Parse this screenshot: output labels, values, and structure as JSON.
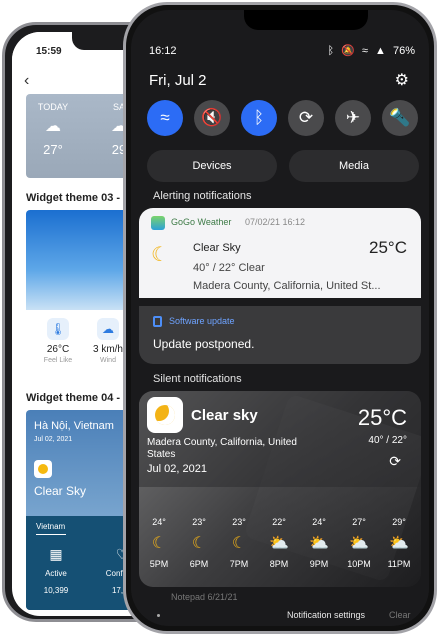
{
  "back_phone": {
    "time": "15:59",
    "back_arrow": "‹",
    "forecast": [
      {
        "day": "TODAY",
        "icon": "cloud-icon",
        "temp": "27°"
      },
      {
        "day": "SA",
        "icon": "cloud-icon",
        "temp": "29"
      }
    ],
    "theme3_label": "Widget theme 03 - Cl",
    "theme3_metrics": [
      {
        "value": "26°C",
        "sub": "Feel Like",
        "icon": "thermometer-icon"
      },
      {
        "value": "3 km/h",
        "sub": "Wind",
        "icon": "wind-icon"
      }
    ],
    "theme4_label": "Widget theme 04 - Co",
    "theme4": {
      "city": "Hà Nội, Vietnam",
      "date": "Jul 02, 2021",
      "condition": "Clear Sky",
      "tab": "Vietnam",
      "stats": [
        {
          "label": "Active",
          "value": "10,399",
          "icon": "hospital-icon"
        },
        {
          "label": "Confirme",
          "value": "17,90",
          "icon": "hands-icon"
        }
      ]
    }
  },
  "front_phone": {
    "status_time": "16:12",
    "status_icons": [
      "bluetooth-icon",
      "mute-icon",
      "wifi-icon",
      "signal-icon"
    ],
    "battery": "76%",
    "date": "Fri, Jul 2",
    "quick_settings": [
      {
        "name": "wifi",
        "icon": "≈",
        "on": true
      },
      {
        "name": "sound",
        "icon": "🔇",
        "on": false
      },
      {
        "name": "bluetooth",
        "icon": "ᛒ",
        "on": true
      },
      {
        "name": "rotate",
        "icon": "⟳",
        "on": false
      },
      {
        "name": "airplane",
        "icon": "✈",
        "on": false
      },
      {
        "name": "flashlight",
        "icon": "🔦",
        "on": false
      }
    ],
    "devices_label": "Devices",
    "media_label": "Media",
    "alerting_label": "Alerting notifications",
    "gogo": {
      "app": "GoGo Weather",
      "time": "07/02/21 16:12",
      "title": "Clear Sky",
      "subtitle": "40° / 22° Clear",
      "location": "Madera County, California, United St...",
      "temp": "25°C"
    },
    "update": {
      "app": "Software update",
      "text": "Update postponed."
    },
    "silent_label": "Silent notifications",
    "silent": {
      "title": "Clear sky",
      "location": "Madera County, California, United States",
      "date": "Jul 02, 2021",
      "temp": "25°C",
      "range": "40° / 22°",
      "hourly": [
        {
          "temp": "24°",
          "time": "5PM",
          "icon": "moon-icon"
        },
        {
          "temp": "23°",
          "time": "6PM",
          "icon": "moon-icon"
        },
        {
          "temp": "23°",
          "time": "7PM",
          "icon": "moon-icon"
        },
        {
          "temp": "22°",
          "time": "8PM",
          "icon": "partly-cloudy-icon"
        },
        {
          "temp": "24°",
          "time": "9PM",
          "icon": "partly-cloudy-icon"
        },
        {
          "temp": "27°",
          "time": "10PM",
          "icon": "partly-cloudy-icon"
        },
        {
          "temp": "29°",
          "time": "11PM",
          "icon": "partly-cloudy-icon"
        }
      ]
    },
    "ghost_text": "Notepad 6/21/21",
    "notification_settings": "Notification settings",
    "clear": "Clear"
  }
}
